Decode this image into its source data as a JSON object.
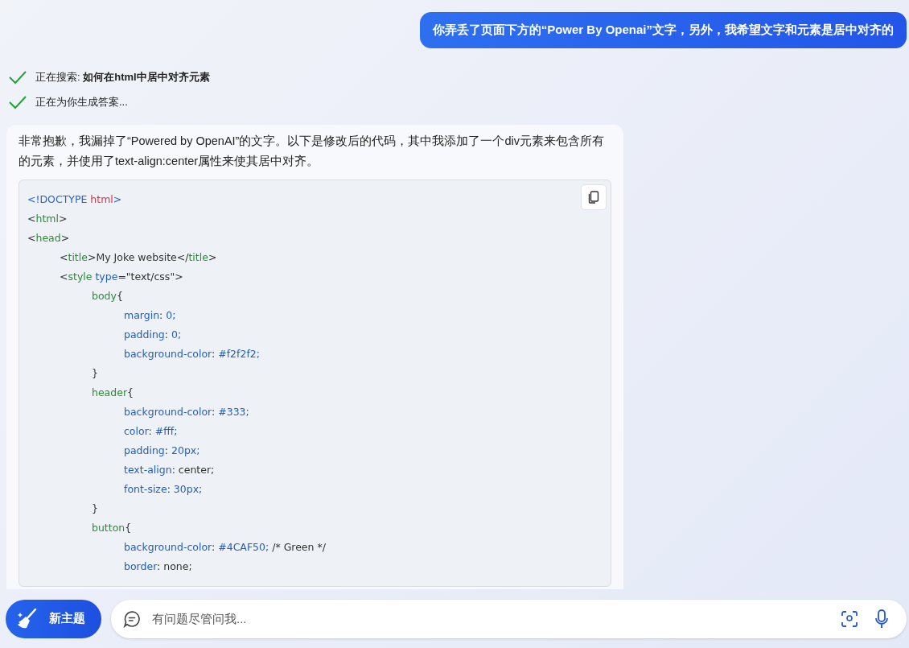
{
  "user_message": "你弄丢了页面下方的“Power By Openai”文字，另外，我希望文字和元素是居中对齐的",
  "steps": [
    {
      "text": "正在搜索: **如何在html中居中对齐元素**",
      "done": true
    },
    {
      "text": "正在为你生成答案...",
      "done": true
    }
  ],
  "answer": {
    "text": "非常抱歉，我漏掉了“Powered by OpenAI”的文字。以下是修改后的代码，其中我添加了一个div元素来包含所有的元素，并使用了text-align:center属性来使其居中对齐。",
    "code_lines": [
      {
        "tokens": [
          {
            "kind": "doctype",
            "text": "<!DOCTYPE "
          },
          {
            "kind": "keyword",
            "text": "html"
          },
          {
            "kind": "doctype",
            "text": ">"
          }
        ]
      },
      {
        "tokens": [
          {
            "kind": "text",
            "text": "<"
          },
          {
            "kind": "tag",
            "text": "html"
          },
          {
            "kind": "text",
            "text": ">"
          }
        ]
      },
      {
        "tokens": [
          {
            "kind": "text",
            "text": "<"
          },
          {
            "kind": "tag",
            "text": "head"
          },
          {
            "kind": "text",
            "text": ">"
          }
        ],
        "children": [
          {
            "tokens": [
              {
                "kind": "text",
                "text": "<"
              },
              {
                "kind": "tag",
                "text": "title"
              },
              {
                "kind": "text",
                "text": ">My Joke website</"
              },
              {
                "kind": "tag",
                "text": "title"
              },
              {
                "kind": "text",
                "text": ">"
              }
            ]
          },
          {
            "tokens": [
              {
                "kind": "text",
                "text": "<"
              },
              {
                "kind": "tag",
                "text": "style"
              },
              {
                "kind": "attr",
                "text": " type"
              },
              {
                "kind": "text",
                "text": "=\"text/css\">"
              }
            ],
            "children": [
              {
                "tokens": [
                  {
                    "kind": "tag",
                    "text": "body"
                  },
                  {
                    "kind": "text",
                    "text": "{"
                  }
                ],
                "children": [
                  {
                    "tokens": [
                      {
                        "kind": "attr",
                        "text": "margin"
                      },
                      {
                        "kind": "text",
                        "text": ": "
                      },
                      {
                        "kind": "attr",
                        "text": "0;"
                      }
                    ]
                  },
                  {
                    "tokens": [
                      {
                        "kind": "attr",
                        "text": "padding"
                      },
                      {
                        "kind": "text",
                        "text": ": "
                      },
                      {
                        "kind": "attr",
                        "text": "0;"
                      }
                    ]
                  },
                  {
                    "tokens": [
                      {
                        "kind": "attr",
                        "text": "background-color"
                      },
                      {
                        "kind": "text",
                        "text": ": "
                      },
                      {
                        "kind": "attr",
                        "text": "#f2f2f2;"
                      }
                    ]
                  }
                ]
              },
              {
                "tokens": [
                  {
                    "kind": "text",
                    "text": "}"
                  }
                ]
              },
              {
                "tokens": [
                  {
                    "kind": "tag",
                    "text": "header"
                  },
                  {
                    "kind": "text",
                    "text": "{"
                  }
                ],
                "children": [
                  {
                    "tokens": [
                      {
                        "kind": "attr",
                        "text": "background-color"
                      },
                      {
                        "kind": "text",
                        "text": ": "
                      },
                      {
                        "kind": "attr",
                        "text": "#333;"
                      }
                    ]
                  },
                  {
                    "tokens": [
                      {
                        "kind": "attr",
                        "text": "color"
                      },
                      {
                        "kind": "text",
                        "text": ": "
                      },
                      {
                        "kind": "attr",
                        "text": "#fff;"
                      }
                    ]
                  },
                  {
                    "tokens": [
                      {
                        "kind": "attr",
                        "text": "padding"
                      },
                      {
                        "kind": "text",
                        "text": ": "
                      },
                      {
                        "kind": "attr",
                        "text": "20px;"
                      }
                    ]
                  },
                  {
                    "tokens": [
                      {
                        "kind": "attr",
                        "text": "text-align"
                      },
                      {
                        "kind": "text",
                        "text": ": center;"
                      }
                    ]
                  },
                  {
                    "tokens": [
                      {
                        "kind": "attr",
                        "text": "font-size"
                      },
                      {
                        "kind": "text",
                        "text": ": "
                      },
                      {
                        "kind": "attr",
                        "text": "30px;"
                      }
                    ]
                  }
                ]
              },
              {
                "tokens": [
                  {
                    "kind": "text",
                    "text": "}"
                  }
                ]
              },
              {
                "tokens": [
                  {
                    "kind": "tag",
                    "text": "button"
                  },
                  {
                    "kind": "text",
                    "text": "{"
                  }
                ],
                "children": [
                  {
                    "tokens": [
                      {
                        "kind": "attr",
                        "text": "background-color"
                      },
                      {
                        "kind": "text",
                        "text": ": "
                      },
                      {
                        "kind": "attr",
                        "text": "#4CAF50;"
                      },
                      {
                        "kind": "text",
                        "text": " /* Green */"
                      }
                    ]
                  },
                  {
                    "tokens": [
                      {
                        "kind": "attr",
                        "text": "border"
                      },
                      {
                        "kind": "text",
                        "text": ": none;"
                      }
                    ]
                  }
                ]
              }
            ]
          }
        ]
      }
    ]
  },
  "composer": {
    "new_topic_button": "新主题",
    "placeholder": "有问题尽管问我..."
  }
}
